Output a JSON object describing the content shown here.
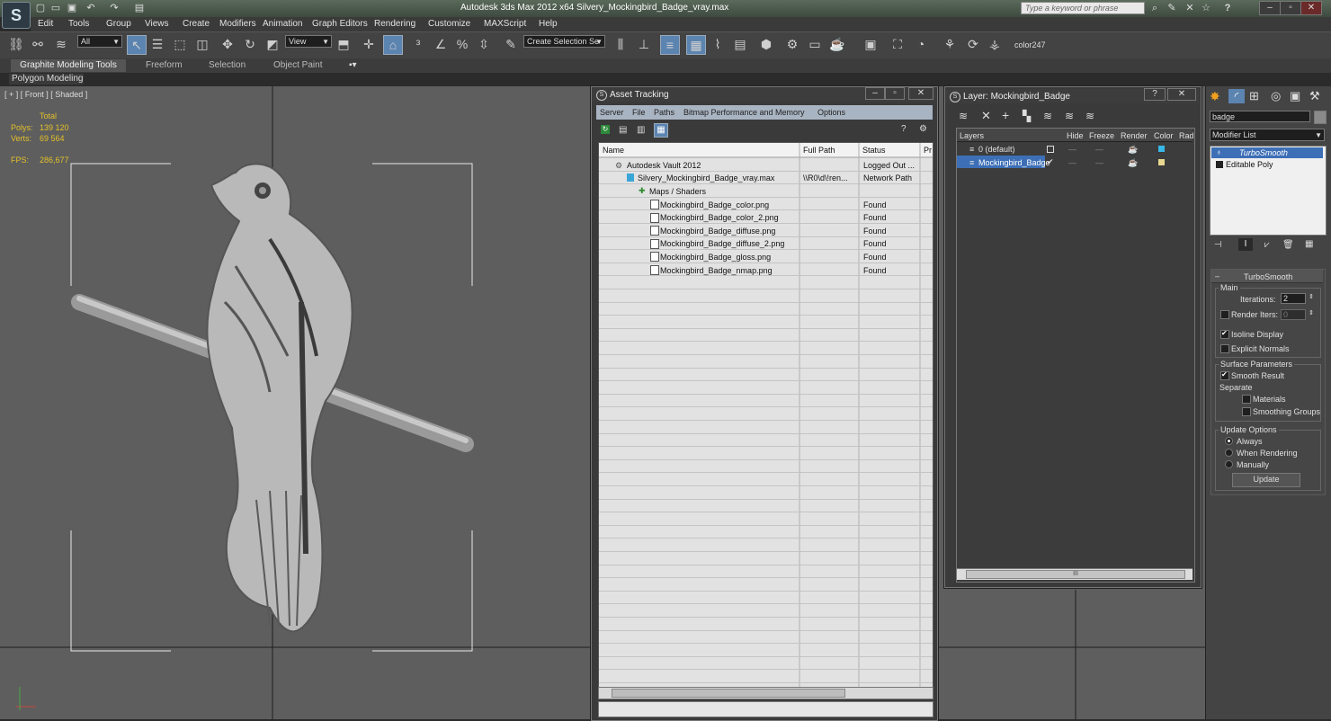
{
  "app": {
    "logo": "S",
    "title": "Autodesk 3ds Max  2012 x64     Silvery_Mockingbird_Badge_vray.max",
    "search_placeholder": "Type a keyword or phrase",
    "help": "?"
  },
  "menu": [
    "Edit",
    "Tools",
    "Group",
    "Views",
    "Create",
    "Modifiers",
    "Animation",
    "Graph Editors",
    "Rendering",
    "Customize",
    "MAXScript",
    "Help"
  ],
  "toolbar": {
    "filter": "All",
    "ref_coord": "View",
    "selection_set": "Create Selection Se",
    "color_label": "color247"
  },
  "ribbon": {
    "tabs": [
      "Graphite Modeling Tools",
      "Freeform",
      "Selection",
      "Object Paint"
    ],
    "subpanel": "Polygon Modeling"
  },
  "viewport": {
    "label": "[ + ] [ Front ] [ Shaded ]",
    "stats": {
      "total": "Total",
      "polys_label": "Polys:",
      "polys": "139 120",
      "verts_label": "Verts:",
      "verts": "69 564",
      "fps_label": "FPS:",
      "fps": "286,677"
    }
  },
  "asset_tracking": {
    "title": "Asset Tracking",
    "menu": [
      "Server",
      "File",
      "Paths",
      "Bitmap Performance and Memory",
      "Options"
    ],
    "columns": [
      "Name",
      "Full Path",
      "Status",
      "Pr"
    ],
    "rows": [
      {
        "name": "Autodesk Vault 2012",
        "path": "",
        "status": "Logged Out ...",
        "indent": 0
      },
      {
        "name": "Silvery_Mockingbird_Badge_vray.max",
        "path": "\\\\R0\\d\\!ren...",
        "status": "Network Path",
        "indent": 1
      },
      {
        "name": "Maps / Shaders",
        "path": "",
        "status": "",
        "indent": 2
      },
      {
        "name": "Mockingbird_Badge_color.png",
        "path": "",
        "status": "Found",
        "indent": 3
      },
      {
        "name": "Mockingbird_Badge_color_2.png",
        "path": "",
        "status": "Found",
        "indent": 3
      },
      {
        "name": "Mockingbird_Badge_diffuse.png",
        "path": "",
        "status": "Found",
        "indent": 3
      },
      {
        "name": "Mockingbird_Badge_diffuse_2.png",
        "path": "",
        "status": "Found",
        "indent": 3
      },
      {
        "name": "Mockingbird_Badge_gloss.png",
        "path": "",
        "status": "Found",
        "indent": 3
      },
      {
        "name": "Mockingbird_Badge_nmap.png",
        "path": "",
        "status": "Found",
        "indent": 3
      }
    ]
  },
  "layer_dialog": {
    "title": "Layer: Mockingbird_Badge",
    "help": "?",
    "columns": [
      "Layers",
      "Hide",
      "Freeze",
      "Render",
      "Color",
      "Rad"
    ],
    "rows": [
      {
        "name": "0 (default)",
        "color": "#38b8e8"
      },
      {
        "name": "Mockingbird_Badge",
        "color": "#e8d890"
      }
    ],
    "scroll": "III"
  },
  "command_panel": {
    "name_field": "badge",
    "modifier_list": "Modifier List",
    "stack": [
      "TurboSmooth",
      "Editable Poly"
    ],
    "turbosmooth": {
      "title": "TurboSmooth",
      "main": "Main",
      "iterations_label": "Iterations:",
      "iterations": "2",
      "render_iters_label": "Render Iters:",
      "render_iters": "0",
      "isoline": "Isoline Display",
      "explicit_normals": "Explicit Normals",
      "surface_params": "Surface Parameters",
      "smooth_result": "Smooth Result",
      "separate": "Separate",
      "materials": "Materials",
      "smoothing_groups": "Smoothing Groups",
      "update_options": "Update Options",
      "always": "Always",
      "when_rendering": "When Rendering",
      "manually": "Manually",
      "update": "Update"
    }
  }
}
